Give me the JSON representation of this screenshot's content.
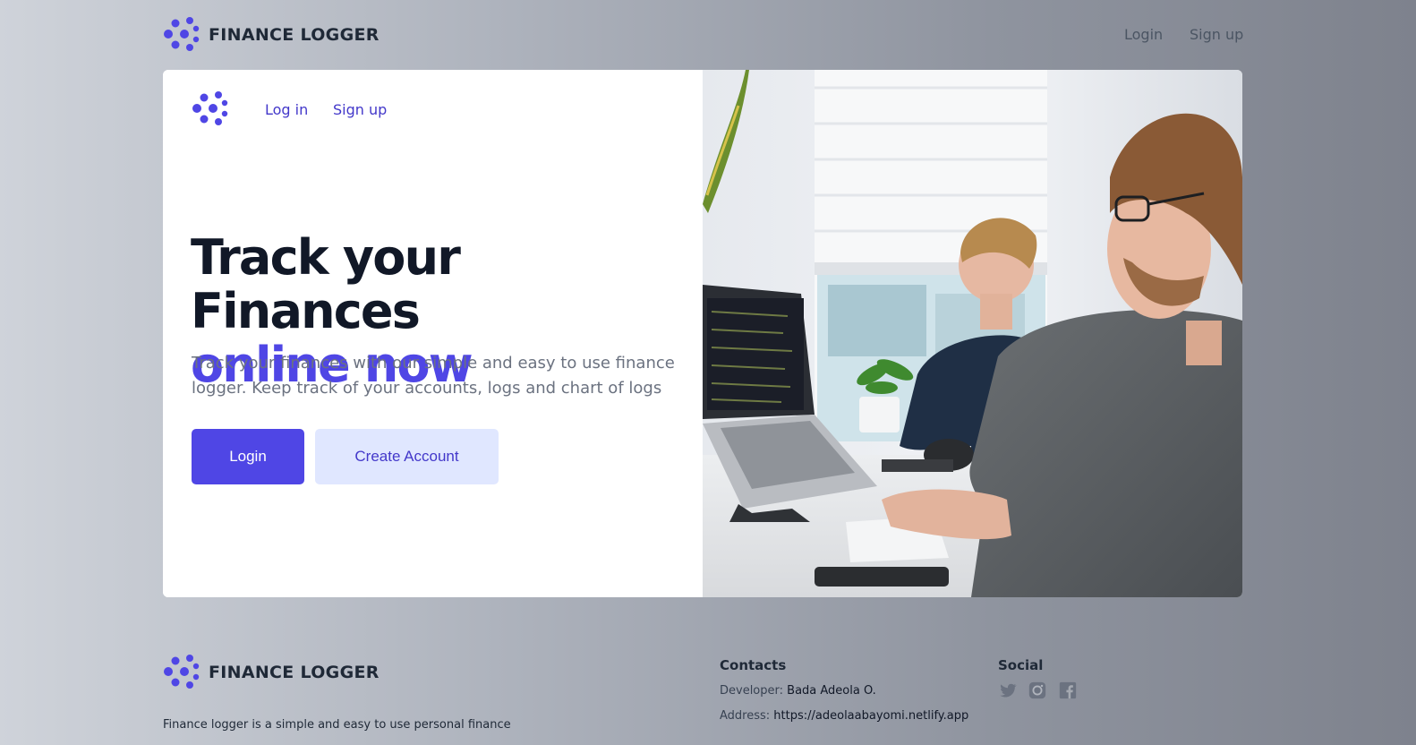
{
  "colors": {
    "accent": "#4f46e5",
    "accent_light": "#e0e7ff",
    "heading": "#111827",
    "muted": "#6b7280"
  },
  "header": {
    "brand": "FINANCE LOGGER",
    "logo_icon": "finance-logger-logo-icon",
    "nav": {
      "login": "Login",
      "signup": "Sign up"
    }
  },
  "hero": {
    "nav": {
      "login": "Log in",
      "signup": "Sign up"
    },
    "title_line1": "Track your Finances",
    "title_line2": "online now",
    "description": "Track your finances with our simple and easy to use finance logger. Keep track of your accounts, logs and chart of logs",
    "login_button": "Login",
    "create_button": "Create Account",
    "image_icon": "office-workers-photo"
  },
  "footer": {
    "brand": "FINANCE LOGGER",
    "description": "Finance logger is a simple and easy to use personal finance",
    "contacts_heading": "Contacts",
    "developer_label": "Developer:",
    "developer_value": "Bada Adeola O.",
    "address_label": "Address:",
    "address_value": "https://adeolaabayomi.netlify.app",
    "social_heading": "Social",
    "social_icons": [
      "twitter-icon",
      "instagram-icon",
      "facebook-icon"
    ]
  }
}
